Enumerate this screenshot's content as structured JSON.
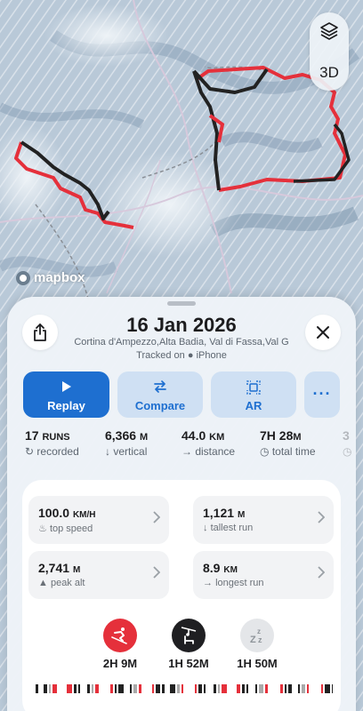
{
  "map": {
    "attribution": "mapbox",
    "mode_label": "3D",
    "layers_icon": "layers-icon",
    "track_colors": {
      "skiing": "#e5303b",
      "lift": "#222222"
    }
  },
  "header": {
    "date": "16 Jan 2026",
    "locations": "Cortina d'Ampezzo,Alta Badia, Val di Fassa,Val G",
    "tracked_prefix": "Tracked on",
    "device": "iPhone"
  },
  "actions": [
    {
      "label": "Replay",
      "icon": "play-icon"
    },
    {
      "label": "Compare",
      "icon": "swap-icon"
    },
    {
      "label": "AR",
      "icon": "ar-icon"
    },
    {
      "label": "···",
      "icon": "more-icon"
    }
  ],
  "summary": [
    {
      "value": "17",
      "unit": "RUNS",
      "label": "recorded"
    },
    {
      "value": "6,366",
      "unit": "M",
      "label": "vertical"
    },
    {
      "value": "44.0",
      "unit": "KM",
      "label": "distance"
    },
    {
      "value": "7H 28",
      "unit": "M",
      "label": "total time"
    }
  ],
  "details": [
    {
      "value": "100.0",
      "unit": "KM/H",
      "label": "top speed"
    },
    {
      "value": "1,121",
      "unit": "M",
      "label": "tallest run"
    },
    {
      "value": "2,741",
      "unit": "M",
      "label": "peak alt"
    },
    {
      "value": "8.9",
      "unit": "KM",
      "label": "longest run"
    }
  ],
  "activities": [
    {
      "name": "skiing",
      "time": "2H 9M",
      "color": "#e5303b"
    },
    {
      "name": "lift",
      "time": "1H 52M",
      "color": "#1f1f22"
    },
    {
      "name": "rest",
      "time": "1H 50M",
      "color": "#e4e6e9"
    }
  ],
  "accent_color": "#1e6fd0"
}
